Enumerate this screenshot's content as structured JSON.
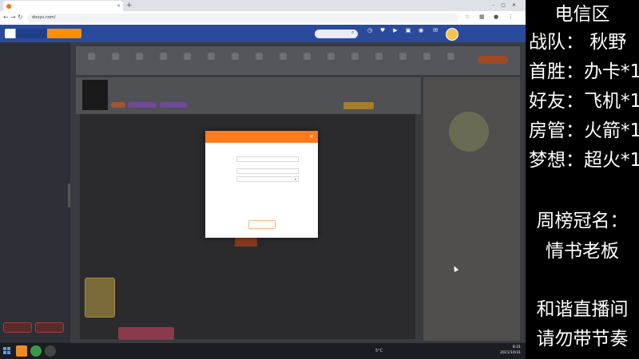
{
  "browser": {
    "tab_title": "",
    "url": "douyu.com/",
    "new_tab": "+",
    "close_tab": "×",
    "window_controls": "–▢✕"
  },
  "site_header": {
    "nav": [
      "",
      "",
      "",
      "",
      "",
      "",
      ""
    ],
    "icons": [
      {
        "icon": "history-icon",
        "label": ""
      },
      {
        "icon": "follow-icon",
        "label": ""
      },
      {
        "icon": "video-icon",
        "label": ""
      },
      {
        "icon": "app-icon",
        "label": ""
      },
      {
        "icon": "live-icon",
        "label": ""
      },
      {
        "icon": "message-icon",
        "label": ""
      }
    ],
    "user_name": ""
  },
  "sidebar": {
    "items": [
      "",
      "",
      "",
      ""
    ],
    "sections": [
      {
        "title": "",
        "rows": [
          [
            "",
            "",
            ""
          ],
          [
            "",
            "",
            ""
          ],
          [
            "",
            "",
            ""
          ],
          [
            "",
            "",
            ""
          ],
          [
            "",
            "",
            ""
          ],
          [
            "",
            "",
            ""
          ]
        ]
      },
      {
        "title": "",
        "rows": [
          [
            "",
            "",
            ""
          ],
          [
            "",
            "",
            ""
          ],
          [
            "",
            "",
            ""
          ]
        ]
      },
      {
        "title": "",
        "rows": [
          [
            "",
            "",
            ""
          ],
          [
            "",
            "",
            ""
          ],
          [
            "",
            "",
            ""
          ],
          [
            "",
            "",
            ""
          ],
          [
            "",
            "",
            ""
          ]
        ]
      }
    ]
  },
  "room": {
    "title": "",
    "follow_label": "",
    "panel_title": "",
    "panel_text": "",
    "player_hint": "",
    "promo_label": ""
  },
  "modal": {
    "title": "",
    "close": "×",
    "rtmp_label": "",
    "rtmp_value": "",
    "key_label": "",
    "key_value": "",
    "copy_label": "",
    "select_value": "",
    "notice": "",
    "notice_link": "",
    "tips_title": "",
    "tip1": "",
    "tip2": "",
    "button": ""
  },
  "taskbar": {
    "weather": "5°C",
    "tray": "",
    "time": "8:31",
    "date": "2021/10/31"
  },
  "overlay": {
    "region": "电信区",
    "team": "战队：  秋野",
    "first_win": "首胜：办卡*1",
    "friend": "好友：飞机*1",
    "room_admin": "房管：火箭*1",
    "dream": "梦想：超火*1",
    "weekly_champion_label": "周榜冠名：",
    "weekly_champion_name": "情书老板",
    "notice_line1": "和谐直播间",
    "notice_line2": "请勿带节奏"
  }
}
